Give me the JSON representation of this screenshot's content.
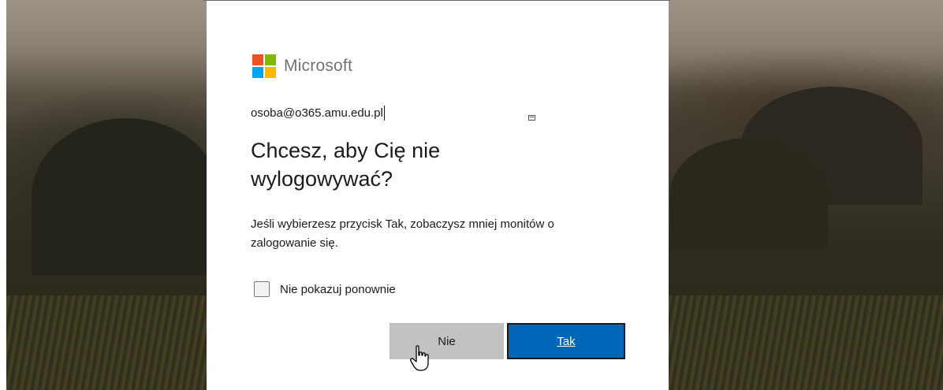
{
  "brand": {
    "name": "Microsoft",
    "colors": {
      "red": "#f25022",
      "green": "#7fba00",
      "blue": "#00a4ef",
      "yellow": "#ffb900"
    }
  },
  "identity": {
    "email": "osoba@o365.amu.edu.pl"
  },
  "dialog": {
    "title": "Chcesz, aby Cię nie wylogowywać?",
    "description": "Jeśli wybierzesz przycisk Tak, zobaczysz mniej monitów o zalogowanie się.",
    "checkbox_label": "Nie pokazuj ponownie",
    "checkbox_checked": false
  },
  "buttons": {
    "no_label": "Nie",
    "yes_label": "Tak"
  },
  "colors": {
    "accent": "#0067b8",
    "secondary_button": "#c2c2c2",
    "text": "#1b1b1b"
  },
  "icons": {
    "cursor": "hand-pointer-icon",
    "small": "window-icon"
  }
}
